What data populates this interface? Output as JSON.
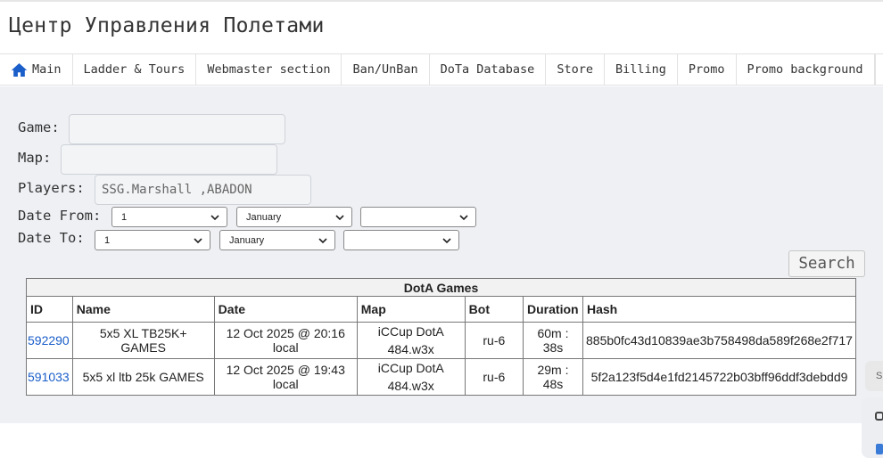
{
  "site": {
    "title": "Центр Управления Полетами"
  },
  "nav": {
    "items": [
      {
        "label": "Main",
        "icon": "home-icon"
      },
      {
        "label": "Ladder & Tours"
      },
      {
        "label": "Webmaster section"
      },
      {
        "label": "Ban/UnBan"
      },
      {
        "label": "DoTa Database"
      },
      {
        "label": "Store"
      },
      {
        "label": "Billing"
      },
      {
        "label": "Promo"
      },
      {
        "label": "Promo background"
      }
    ],
    "accent": "#1a5ec9"
  },
  "filters": {
    "game_label": "Game:",
    "game_value": "",
    "map_label": "Map:",
    "map_value": "",
    "players_label": "Players:",
    "players_value": "SSG.Marshall ,ABADON",
    "date_from_label": "Date From:",
    "date_from": {
      "day": "1",
      "month": "January",
      "year": ""
    },
    "date_to_label": "Date To:",
    "date_to": {
      "day": "1",
      "month": "January",
      "year": ""
    },
    "search_label": "Search"
  },
  "table": {
    "caption": "DotA Games",
    "columns": [
      "ID",
      "Name",
      "Date",
      "Map",
      "Bot",
      "Duration",
      "Hash"
    ],
    "rows": [
      {
        "id": "592290",
        "name": "5x5 XL TB25K+ GAMES",
        "date": "12 Oct 2025 @ 20:16 local",
        "map_line1": "iCCup DotA",
        "map_line2": "484.w3x",
        "bot": "ru-6",
        "duration": "60m : 38s",
        "hash": "885b0fc43d10839ae3b758498da589f268e2f717"
      },
      {
        "id": "591033",
        "name": "5x5 xl ltb 25k GAMES",
        "date": "12 Oct 2025 @ 19:43 local",
        "map_line1": "iCCup DotA",
        "map_line2": "484.w3x",
        "bot": "ru-6",
        "duration": "29m : 48s",
        "hash": "5f2a123f5d4e1fd2145722b03bff96ddf3debdd9"
      }
    ]
  },
  "side_widget": {
    "label": "S"
  }
}
